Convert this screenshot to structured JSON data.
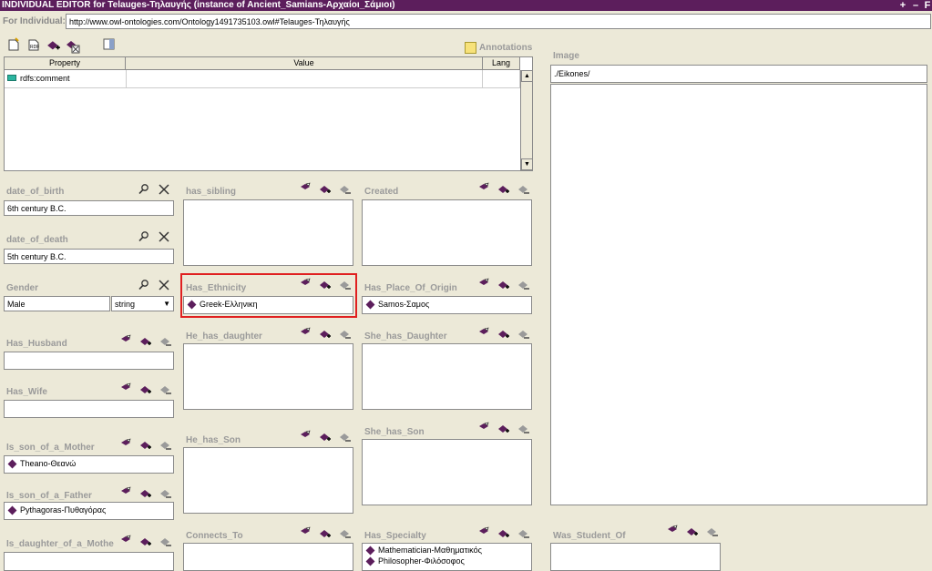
{
  "window": {
    "title": "INDIVIDUAL EDITOR for Telauges-Τηλαυγής   (instance of Ancient_Samians-Αρχαίοι_Σάμιοι)",
    "controls": [
      "+",
      "–",
      "F"
    ]
  },
  "individual": {
    "label": "For Individual:",
    "uri": "http://www.owl-ontologies.com/Ontology1491735103.owl#Telauges-Τηλαυγής"
  },
  "annotations": {
    "label": "Annotations",
    "columns": [
      "Property",
      "Value",
      "Lang"
    ],
    "rows": [
      {
        "property": "rdfs:comment",
        "value": "",
        "lang": ""
      }
    ]
  },
  "image": {
    "label": "Image",
    "value": "./Eikones/"
  },
  "fields": {
    "date_of_birth": {
      "label": "date_of_birth",
      "value": "6th century B.C."
    },
    "date_of_death": {
      "label": "date_of_death",
      "value": "5th century B.C."
    },
    "gender": {
      "label": "Gender",
      "value": "Male",
      "type": "string"
    },
    "has_husband": {
      "label": "Has_Husband"
    },
    "has_wife": {
      "label": "Has_Wife"
    },
    "is_son_of_a_mother": {
      "label": "Is_son_of_a_Mother",
      "items": [
        "Theano-Θεανώ"
      ]
    },
    "is_son_of_a_father": {
      "label": "Is_son_of_a_Father",
      "items": [
        "Pythagoras-Πυθαγόρας"
      ]
    },
    "is_daughter_of_a_mother": {
      "label": "Is_daughter_of_a_Mothe"
    },
    "has_sibling": {
      "label": "has_sibling"
    },
    "has_ethnicity": {
      "label": "Has_Ethnicity",
      "items": [
        "Greek-Ελληνικη"
      ]
    },
    "he_has_daughter": {
      "label": "He_has_daughter"
    },
    "he_has_son": {
      "label": "He_has_Son"
    },
    "connects_to": {
      "label": "Connects_To"
    },
    "created": {
      "label": "Created"
    },
    "has_place_of_origin": {
      "label": "Has_Place_Of_Origin",
      "items": [
        "Samos-Σαμος"
      ]
    },
    "she_has_daughter": {
      "label": "She_has_Daughter"
    },
    "she_has_son": {
      "label": "She_has_Son"
    },
    "has_specialty": {
      "label": "Has_Specialty",
      "items": [
        "Mathematician-Μαθηματικός",
        "Philosopher-Φιλόσοφος"
      ]
    },
    "was_student_of": {
      "label": "Was_Student_Of"
    }
  },
  "colors": {
    "titlebar": "#5c1e5c",
    "background": "#ece9d8",
    "label": "#9a9a9a",
    "highlight": "#e02020"
  }
}
